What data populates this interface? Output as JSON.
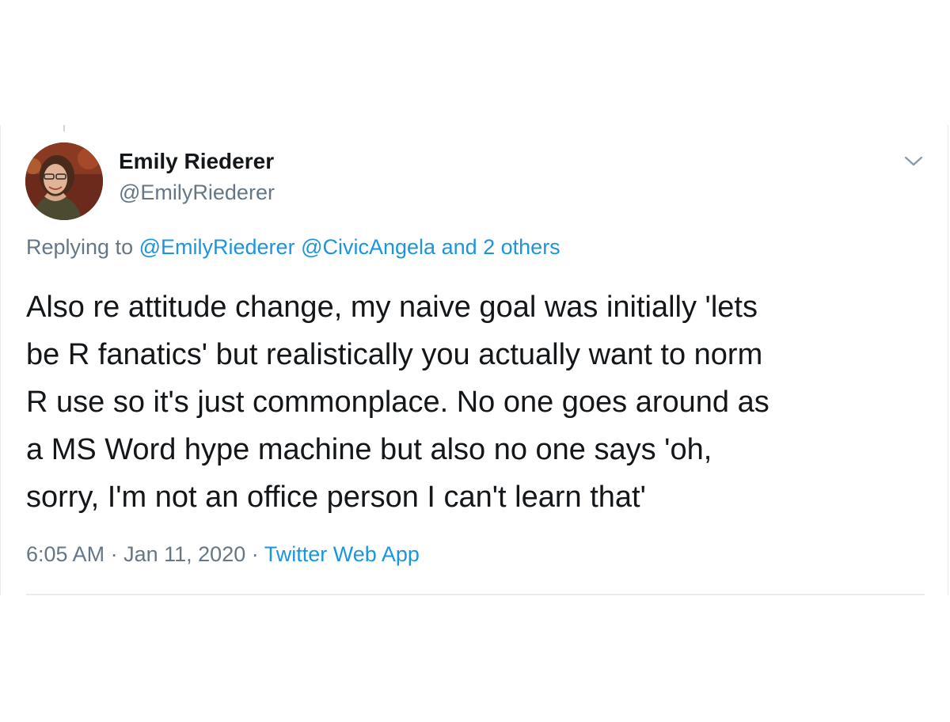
{
  "tweet": {
    "author": {
      "display_name": "Emily Riederer",
      "handle": "@EmilyRiederer"
    },
    "replying_to": {
      "prefix": "Replying to",
      "mentions": [
        "@EmilyRiederer",
        "@CivicAngela"
      ],
      "others": "and 2 others"
    },
    "text_lines": [
      "Also re attitude change, my naive goal was initially 'lets",
      "be R fanatics' but realistically you actually want to norm",
      "R use so it's just commonplace. No one goes around as",
      "a MS Word hype machine but also no one says 'oh,",
      "sorry, I'm not an office person I can't learn that'"
    ],
    "time": "6:05 AM",
    "date": "Jan 11, 2020",
    "separator": "·",
    "source": "Twitter Web App"
  },
  "icons": {
    "more_menu": "chevron-down-icon"
  },
  "colors": {
    "text": "#14171a",
    "secondary": "#657786",
    "link": "#1b95e0",
    "divider": "#e6ecf0"
  }
}
